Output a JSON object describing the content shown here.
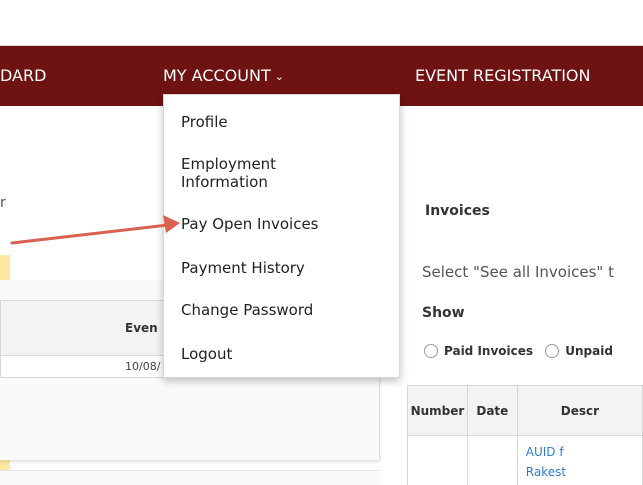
{
  "nav": {
    "dashboard_fragment": "DARD",
    "my_account": "MY ACCOUNT",
    "event_registration": "EVENT REGISTRATION"
  },
  "dropdown": {
    "items": [
      "Profile",
      "Employment Information",
      "Pay Open Invoices",
      "Payment History",
      "Change Password",
      "Logout"
    ]
  },
  "left": {
    "mark": "r",
    "table_header": "Even",
    "table_date": "10/08/"
  },
  "invoices": {
    "title": "Invoices",
    "help": "Select \"See all Invoices\" t",
    "show_label": "Show",
    "radio_paid": "Paid Invoices",
    "radio_unpaid": "Unpaid",
    "columns": [
      "Number",
      "Date",
      "Descr"
    ],
    "row_desc_line1": "AUID f",
    "row_desc_line2": "Rakest"
  },
  "colors": {
    "nav_bg": "#6e1312",
    "page_bg": "#fbf6e9",
    "arrow": "#d8624f",
    "link": "#2f7bd1"
  }
}
